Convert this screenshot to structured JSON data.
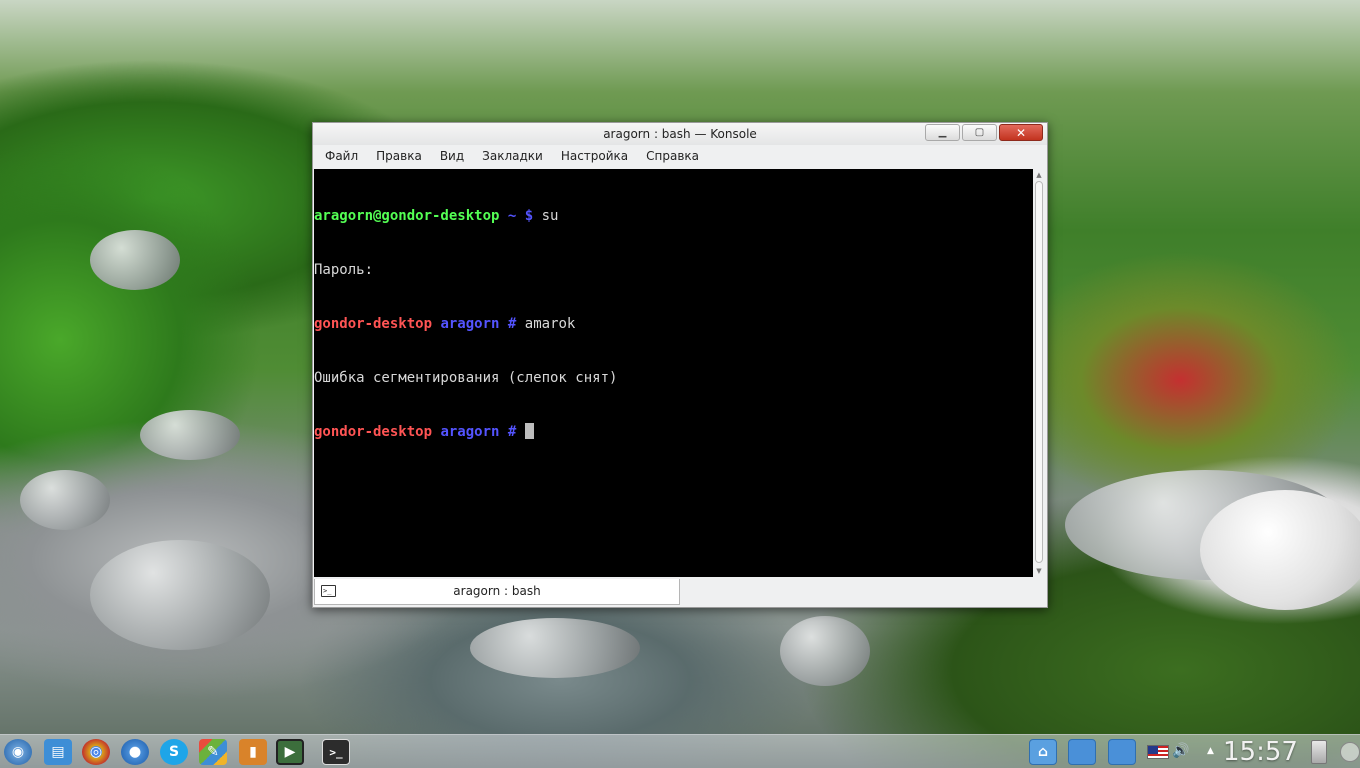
{
  "window": {
    "title": "aragorn : bash — Konsole",
    "buttons": {
      "minimize": "▁",
      "maximize": "▢",
      "close": "✕"
    }
  },
  "menu": [
    "Файл",
    "Правка",
    "Вид",
    "Закладки",
    "Настройка",
    "Справка"
  ],
  "terminal": {
    "line1": {
      "prompt": "aragorn@gondor-desktop",
      "cwd": "~",
      "symbol": "$",
      "command": "su"
    },
    "line2": "Пароль:",
    "line3": {
      "host": "gondor-desktop",
      "cwd": "aragorn",
      "symbol": "#",
      "command": "amarok"
    },
    "line4": "Ошибка сегментирования (слепок снят)",
    "line5": {
      "host": "gondor-desktop",
      "cwd": "aragorn",
      "symbol": "#"
    }
  },
  "tab": {
    "label": "aragorn : bash",
    "icon_text": ">_"
  },
  "taskbar": {
    "apps": [
      {
        "name": "kde-menu-icon",
        "glyph": "◉",
        "color": "#2a6fb5"
      },
      {
        "name": "file-manager-icon",
        "glyph": "▤",
        "color": "#3d8ed6"
      },
      {
        "name": "chrome-icon",
        "glyph": "◎",
        "color": "#d9a21b"
      },
      {
        "name": "chromium-icon",
        "glyph": "◎",
        "color": "#4a8fd8"
      },
      {
        "name": "skype-icon",
        "glyph": "S",
        "color": "#1ea5e8"
      },
      {
        "name": "office-icon",
        "glyph": "✎",
        "color": "#6bb23c"
      },
      {
        "name": "book-icon",
        "glyph": "▮",
        "color": "#d9832a"
      },
      {
        "name": "media-player-icon",
        "glyph": "▶",
        "color": "#3c6e3c"
      },
      {
        "name": "konsole-icon",
        "glyph": ">_",
        "color": "#2c2c2c"
      }
    ],
    "tray": {
      "clock": "15:57",
      "volume_glyph": "🔊",
      "arrow_glyph": "▲"
    }
  }
}
